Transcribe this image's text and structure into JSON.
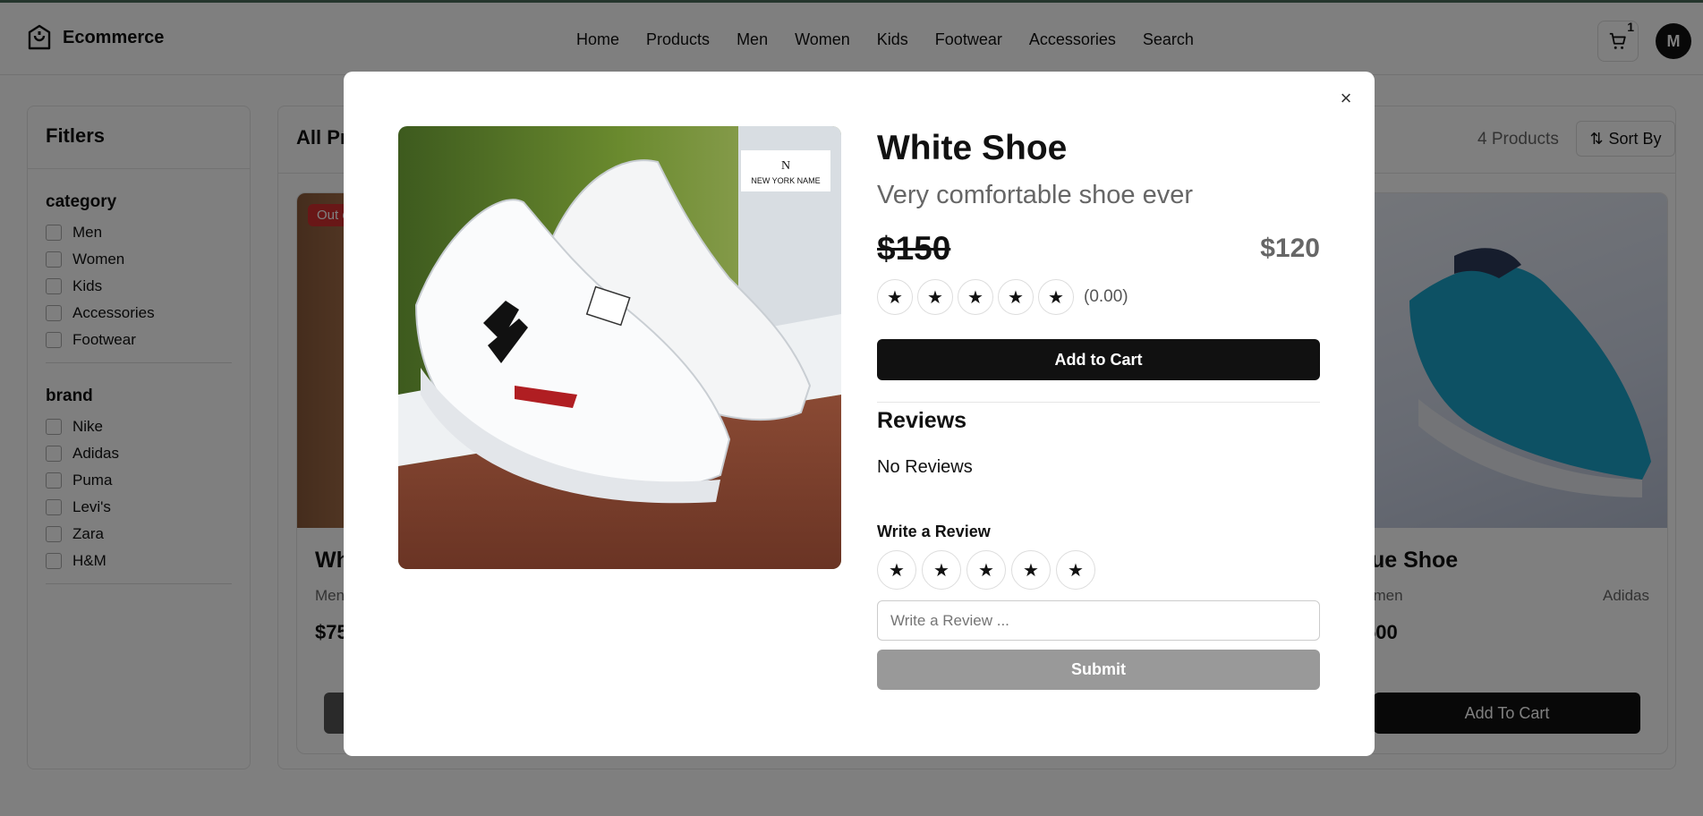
{
  "header": {
    "brand": "Ecommerce",
    "nav": [
      "Home",
      "Products",
      "Men",
      "Women",
      "Kids",
      "Footwear",
      "Accessories",
      "Search"
    ],
    "cart_count": "1",
    "avatar_initial": "M"
  },
  "sidebar": {
    "title": "Fitlers",
    "category_label": "category",
    "categories": [
      "Men",
      "Women",
      "Kids",
      "Accessories",
      "Footwear"
    ],
    "brand_label": "brand",
    "brands": [
      "Nike",
      "Adidas",
      "Puma",
      "Levi's",
      "Zara",
      "H&M"
    ]
  },
  "listing": {
    "heading": "All Pr",
    "count": "4 Products",
    "sort_label": "Sort By",
    "cards": [
      {
        "badge": "Out o",
        "name": "Wh",
        "category": "Men",
        "price": "$75",
        "button": ""
      },
      {
        "name": "lue Shoe",
        "category": "omen",
        "brand": "Adidas",
        "price": "500",
        "button": "Add To Cart"
      }
    ]
  },
  "modal": {
    "title": "White Shoe",
    "description": "Very comfortable shoe ever",
    "old_price": "$150",
    "new_price": "$120",
    "rating_text": "(0.00)",
    "add_to_cart": "Add to Cart",
    "reviews_heading": "Reviews",
    "no_reviews": "No Reviews",
    "write_review_heading": "Write a Review",
    "review_placeholder": "Write a Review ...",
    "submit": "Submit",
    "close_symbol": "×",
    "star_symbol": "★",
    "image_tag_letter": "N",
    "image_tag_text": "NEW YORK NAME"
  }
}
